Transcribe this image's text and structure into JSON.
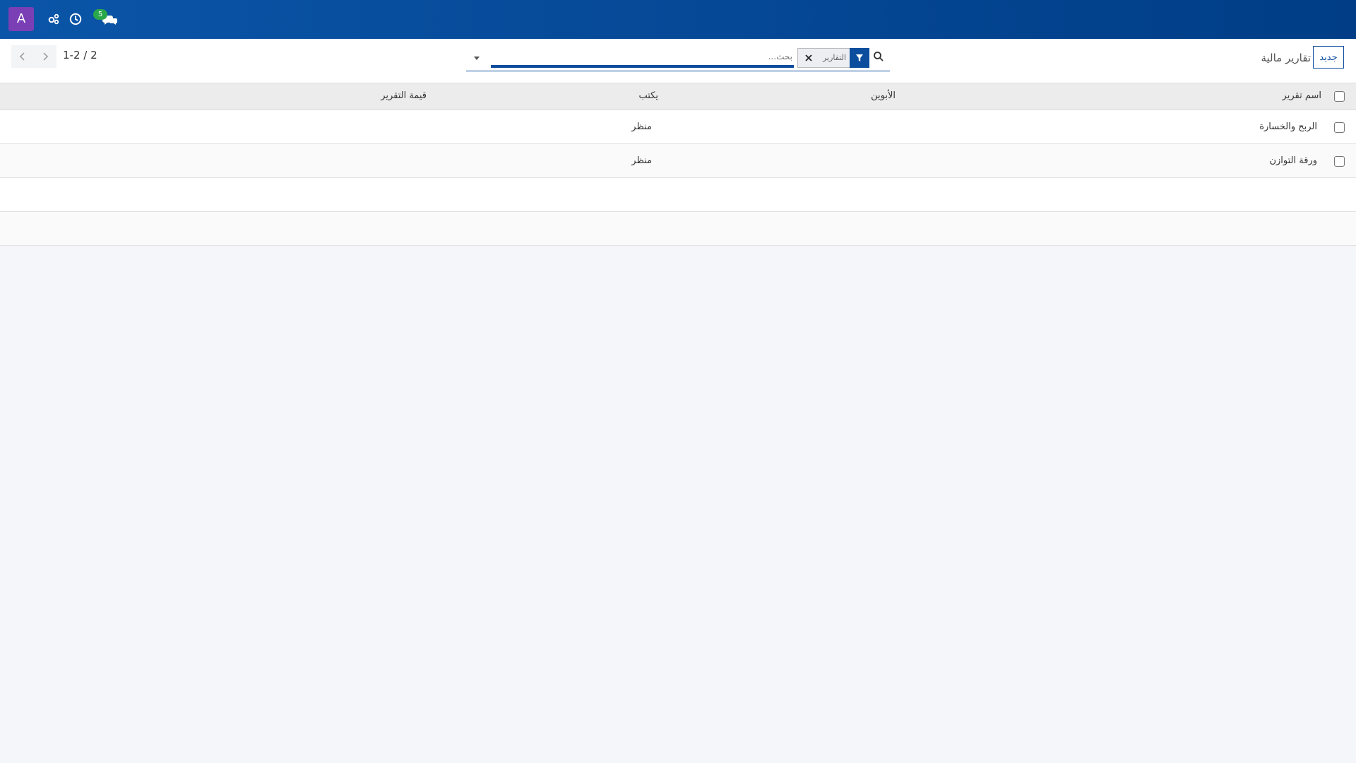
{
  "topbar": {
    "avatar_letter": "A",
    "chat_badge_count": "5"
  },
  "controlbar": {
    "new_label": "جديد",
    "title": "تقارير مالية",
    "pager": "1-2 / 2"
  },
  "search": {
    "placeholder": "بحث...",
    "facet_label": "التقارير"
  },
  "table": {
    "columns": [
      "اسم تقرير",
      "الأبوين",
      "يكتب",
      "قيمة التقرير"
    ],
    "rows": [
      [
        "الربح والخسارة",
        "",
        "منظر",
        ""
      ],
      [
        "ورقة التوازن",
        "",
        "منظر",
        ""
      ]
    ]
  }
}
